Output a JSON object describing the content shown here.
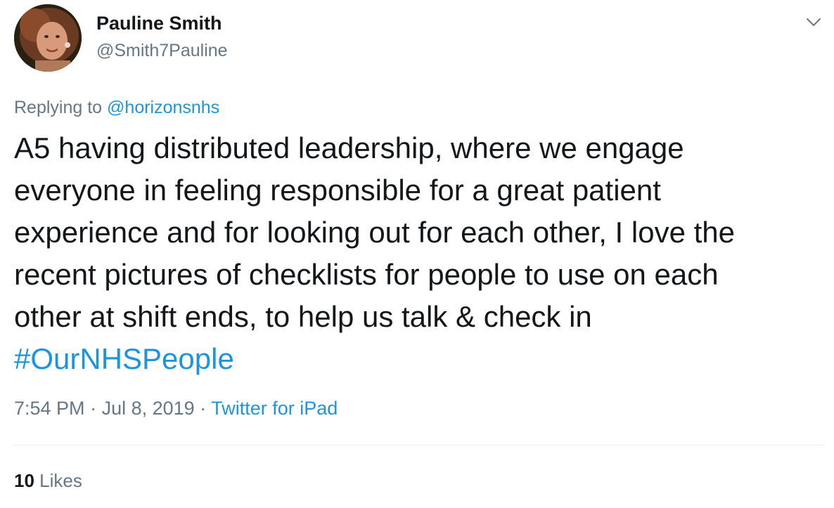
{
  "author": {
    "display_name": "Pauline Smith",
    "handle": "@Smith7Pauline"
  },
  "reply": {
    "prefix": "Replying to",
    "target": "@horizonsnhs"
  },
  "tweet": {
    "text": "A5 having distributed leadership, where we engage\neveryone in feeling responsible for a great patient\nexperience and for looking out for each other, I love the\nrecent pictures of checklists for people to use on each\nother at shift ends, to help us talk & check in",
    "hashtag": "#OurNHSPeople"
  },
  "meta": {
    "time": "7:54 PM",
    "separator": " · ",
    "date": "Jul 8, 2019",
    "source": "Twitter for iPad"
  },
  "stats": {
    "likes_count": "10",
    "likes_label": "Likes"
  },
  "colors": {
    "link": "#1b95e0",
    "muted": "#657786",
    "text": "#14171a",
    "divider": "#e6ecf0"
  },
  "icons": {
    "menu": "chevron-down-icon"
  }
}
